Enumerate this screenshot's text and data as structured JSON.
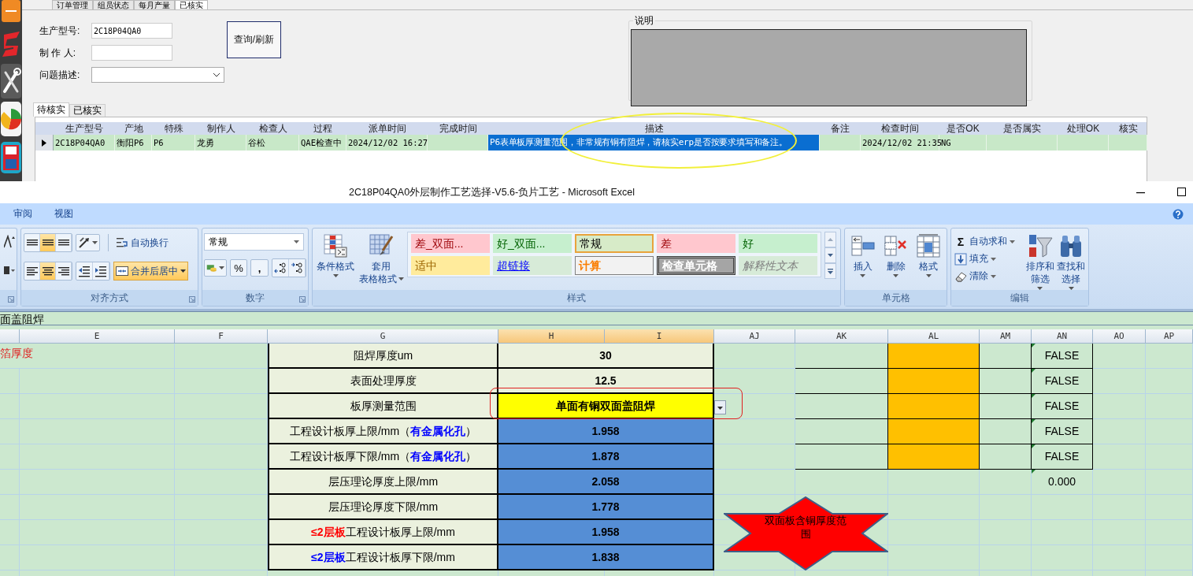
{
  "app": {
    "top_tabs": [
      {
        "label": "订单管理",
        "selected": false
      },
      {
        "label": "组员状态",
        "selected": false
      },
      {
        "label": "每月产量",
        "selected": false
      },
      {
        "label": "已核实",
        "selected": true
      }
    ],
    "form": [
      {
        "label": "生产型号:",
        "value": "2C18P04QA0",
        "kind": "text"
      },
      {
        "label": "制 作 人:",
        "kind": "text"
      },
      {
        "label": "问题描述:",
        "kind": "dropdown"
      }
    ],
    "query_button": "查询/刷新",
    "note_box": {
      "title": "说明"
    },
    "tabs": [
      {
        "label": "待核实",
        "selected": true
      },
      {
        "label": "已核实",
        "selected": false
      }
    ],
    "grid": {
      "columns": [
        "生产型号",
        "产地",
        "特殊",
        "制作人",
        "检查人",
        "过程",
        "派单时间",
        "完成时间",
        "描述",
        "备注",
        "检查时间",
        "是否OK",
        "是否属实",
        "处理OK",
        "核实"
      ],
      "rows": [
        {
          "current": true,
          "cells": [
            {
              "text": "2C18P04QA0",
              "selected": false
            },
            {
              "text": "衡阳P6",
              "selected": false
            },
            {
              "text": "P6",
              "selected": false
            },
            {
              "text": "龙勇",
              "selected": false
            },
            {
              "text": "谷松",
              "selected": false
            },
            {
              "text": "QAE检查中",
              "selected": false
            },
            {
              "text": "2024/12/02 16:27",
              "selected": false
            },
            {
              "selected": false
            },
            {
              "text": "P6表单板厚测量范围，非常规有铜有阻焊，请核实erp是否按要求填写和备注。",
              "selected": true
            },
            {
              "selected": false
            },
            {
              "text": "2024/12/02 21:35",
              "selected": false
            },
            {
              "text": "NG",
              "selected": false
            },
            {
              "selected": false
            },
            {
              "selected": false
            },
            {
              "selected": false
            }
          ]
        }
      ]
    }
  },
  "excel": {
    "title": "2C18P04QA0外层制作工艺选择-V5.6-负片工艺 - Microsoft Excel",
    "menu_tabs": [
      "审阅",
      "视图"
    ],
    "ribbon": {
      "alignment": {
        "label": "对齐方式",
        "vertical": [
          {
            "selected": false
          },
          {
            "selected": true
          },
          {
            "selected": false
          }
        ],
        "horizontal": [
          {
            "selected": false
          },
          {
            "selected": true
          },
          {
            "selected": false
          }
        ],
        "wrap": {
          "label": "自动换行",
          "selected": false
        },
        "merge": {
          "label": "合并后居中",
          "selected": true
        }
      },
      "number": {
        "label": "数字",
        "format": "常规",
        "percent": "%",
        "comma": ","
      },
      "styles": {
        "label": "样式",
        "conditional": "条件格式",
        "table_format": [
          "套用",
          "表格格式"
        ],
        "gallery": [
          {
            "label": "差_双面...",
            "kind": "bad",
            "selected": false
          },
          {
            "label": "好_双面...",
            "kind": "good",
            "selected": false
          },
          {
            "label": "常规",
            "kind": "normal",
            "selected": true
          },
          {
            "label": "差",
            "kind": "bad",
            "selected": false
          },
          {
            "label": "好",
            "kind": "good",
            "selected": false
          },
          {
            "label": "适中",
            "kind": "neutral",
            "selected": false
          },
          {
            "label": "超链接",
            "kind": "hyperlink",
            "selected": false
          },
          {
            "label": "计算",
            "kind": "calculation",
            "selected": false
          },
          {
            "label": "检查单元格",
            "kind": "check",
            "selected": false
          },
          {
            "label": "解释性文本",
            "kind": "explanatory",
            "selected": false
          }
        ]
      },
      "cells": {
        "label": "单元格",
        "buttons": [
          "插入",
          "删除",
          "格式"
        ]
      },
      "editing": {
        "label": "编辑",
        "small": [
          {
            "label": "自动求和",
            "symbol": "Σ"
          },
          {
            "label": "填充"
          },
          {
            "label": "清除"
          }
        ],
        "big": [
          "排序和筛选",
          "查找和选择"
        ]
      }
    },
    "formula_bar": "面盖阻焊",
    "sheet": {
      "columns": [
        {
          "label": "E",
          "selected": false
        },
        {
          "label": "F",
          "selected": false
        },
        {
          "label": "G",
          "selected": false
        },
        {
          "label": "H",
          "selected": true
        },
        {
          "label": "I",
          "selected": true
        },
        {
          "label": "AJ",
          "selected": false
        },
        {
          "label": "AK",
          "selected": false
        },
        {
          "label": "AL",
          "selected": false
        },
        {
          "label": "AM",
          "selected": false
        },
        {
          "label": "AN",
          "selected": false
        },
        {
          "label": "AO",
          "selected": false
        },
        {
          "label": "AP",
          "selected": false
        }
      ],
      "rows": [
        {
          "note": "箔厚度",
          "label": "阻焊厚度um",
          "value": "30",
          "kind": "input",
          "side": {
            "boxed": true,
            "text": "FALSE",
            "flag": true
          }
        },
        {
          "label": "表面处理厚度",
          "value": "12.5",
          "kind": "input",
          "side": {
            "boxed": true,
            "text": "FALSE",
            "flag": true
          }
        },
        {
          "label": "板厚测量范围",
          "value": "单面有铜双面盖阻焊",
          "kind": "choice",
          "side": {
            "boxed": true,
            "text": "FALSE",
            "flag": true
          }
        },
        {
          "label": "工程设计板厚上限/mm（**有金属化孔**）",
          "color": "#0000ff",
          "value": "1.958",
          "kind": "computed",
          "side": {
            "boxed": true,
            "text": "FALSE",
            "flag": true
          }
        },
        {
          "label": "工程设计板厚下限/mm（**有金属化孔**）",
          "color": "#0000ff",
          "value": "1.878",
          "kind": "computed",
          "side": {
            "boxed": true,
            "text": "FALSE",
            "flag": true
          }
        },
        {
          "label": "层压理论厚度上限/mm",
          "value": "2.058",
          "kind": "computed",
          "side": {
            "boxed": false,
            "text": "0.000",
            "flag": true
          }
        },
        {
          "label": "层压理论厚度下限/mm",
          "value": "1.778",
          "kind": "computed"
        },
        {
          "label": "**≤2层板**工程设计板厚上限/mm",
          "color": "#ff0000",
          "value": "1.958",
          "kind": "computed"
        },
        {
          "label": "**≤2层板**工程设计板厚下限/mm",
          "color": "#0000ff",
          "value": "1.838",
          "kind": "computed"
        }
      ],
      "shape": {
        "text": "双面板含铜厚度范围"
      }
    }
  }
}
